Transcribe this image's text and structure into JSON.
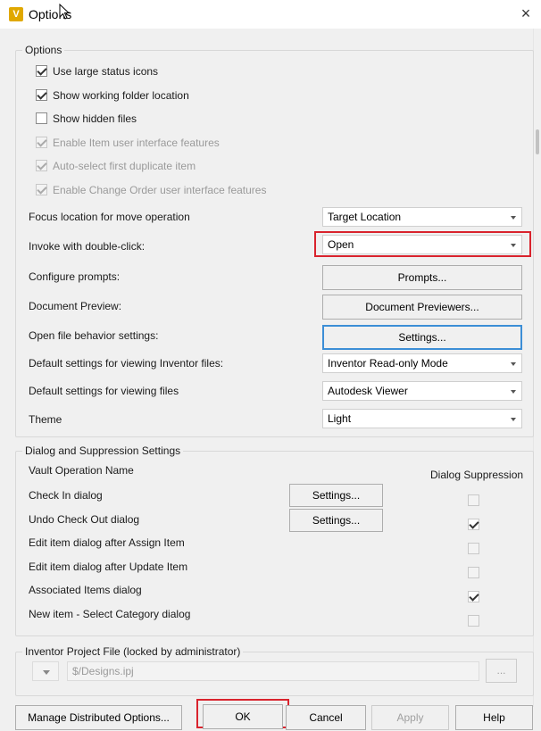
{
  "window": {
    "title": "Options",
    "app_icon": "vault-app-icon",
    "close": "×"
  },
  "options_group": {
    "label": "Options",
    "checkboxes": [
      {
        "label": "Use large status icons",
        "checked": true,
        "enabled": true
      },
      {
        "label": "Show working folder location",
        "checked": true,
        "enabled": true
      },
      {
        "label": "Show hidden files",
        "checked": false,
        "enabled": true
      },
      {
        "label": "Enable Item user interface features",
        "checked": true,
        "enabled": false
      },
      {
        "label": "Auto-select first duplicate item",
        "checked": true,
        "enabled": false
      },
      {
        "label": "Enable Change Order user interface features",
        "checked": true,
        "enabled": false
      }
    ],
    "rows": [
      {
        "label": "Focus location for move operation",
        "control": "combo",
        "value": "Target Location"
      },
      {
        "label": "Invoke with double-click:",
        "control": "combo",
        "value": "Open"
      },
      {
        "label": "Configure prompts:",
        "control": "button",
        "value": "Prompts..."
      },
      {
        "label": "Document Preview:",
        "control": "button",
        "value": "Document Previewers..."
      },
      {
        "label": "Open file behavior settings:",
        "control": "button",
        "value": "Settings..."
      },
      {
        "label": "Default settings for viewing Inventor files:",
        "control": "combo",
        "value": "Inventor Read-only Mode"
      },
      {
        "label": "Default settings for viewing files",
        "control": "combo",
        "value": "Autodesk Viewer"
      },
      {
        "label": "Theme",
        "control": "combo",
        "value": "Light"
      }
    ]
  },
  "dialog_group": {
    "label": "Dialog and Suppression Settings",
    "col_name": "Vault Operation Name",
    "col_suppression": "Dialog Suppression",
    "rows": [
      {
        "label": "Check In dialog",
        "button": "Settings...",
        "suppressed": false
      },
      {
        "label": "Undo Check Out dialog",
        "button": "Settings...",
        "suppressed": true
      },
      {
        "label": "Edit item dialog after Assign Item",
        "button": "",
        "suppressed": false
      },
      {
        "label": "Edit item dialog after Update Item",
        "button": "",
        "suppressed": false
      },
      {
        "label": "Associated Items dialog",
        "button": "",
        "suppressed": true
      },
      {
        "label": "New item - Select Category dialog",
        "button": "",
        "suppressed": false
      }
    ]
  },
  "project_group": {
    "label": "Inventor Project File (locked by administrator)",
    "path": "$/Designs.ipj",
    "browse": "..."
  },
  "footer": {
    "manage": "Manage Distributed Options...",
    "ok": "OK",
    "cancel": "Cancel",
    "apply": "Apply",
    "help": "Help"
  },
  "highlight_color": "#d9232d",
  "focus_color": "#3c8ed6"
}
